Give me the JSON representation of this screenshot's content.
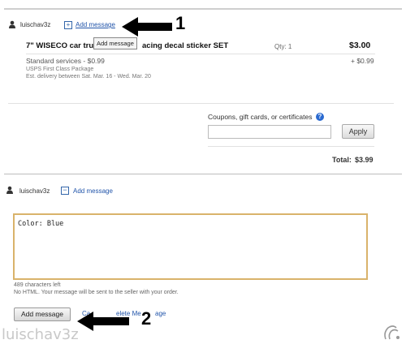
{
  "top": {
    "username": "luischav3z",
    "add_message_link": "Add message",
    "tooltip": "Add message",
    "annotation_1": "1"
  },
  "item": {
    "title_left": "7\" WISECO car tru",
    "title_right": "acing decal sticker SET",
    "qty_label": "Qty: 1",
    "price": "$3.00",
    "shipping_service": "Standard services - $0.99",
    "shipping_package": "USPS First Class Package",
    "shipping_estimate": "Est. delivery between Sat. Mar. 16 - Wed. Mar. 20",
    "shipping_price": "+ $0.99"
  },
  "coupon": {
    "label": "Coupons, gift cards, or certificates",
    "help_icon_text": "?",
    "apply_label": "Apply",
    "input_value": ""
  },
  "total": {
    "label": "Total:",
    "value": "$3.99"
  },
  "bottom": {
    "username": "luischav3z",
    "add_message_link": "Add message",
    "textarea_value": "Color: Blue",
    "chars_left": "489 characters left",
    "note": "No HTML. Your message will be sent to the seller with your order.",
    "add_message_button": "Add message",
    "cancel_link_partial": "Ca",
    "delete_link_partial": "elete Me",
    "delete_link_tail": "age",
    "annotation_2": "2"
  },
  "watermark": "luischav3z",
  "colors": {
    "link": "#2255aa",
    "textarea_border": "#d9b36b",
    "help_icon": "#2a6ad0"
  }
}
